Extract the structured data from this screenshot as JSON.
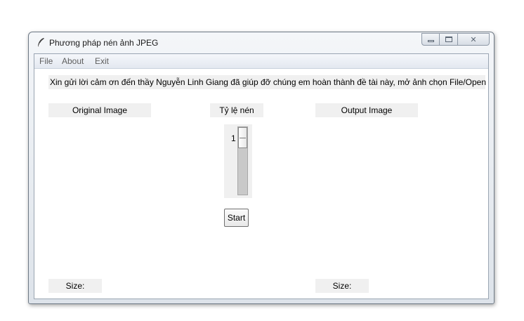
{
  "window": {
    "title": "Phương pháp nén ảnh JPEG",
    "controls": {
      "minimize": "—",
      "maximize": "□",
      "close": "✕"
    }
  },
  "menu": {
    "items": [
      "File",
      "About",
      "Exit"
    ]
  },
  "banner": {
    "text": "Xin gửi lời cảm ơn đến thầy Nguyễn Linh Giang đã giúp đỡ chúng em hoàn thành đề tài này, mở ảnh chọn File/Open"
  },
  "panels": {
    "original_label": "Original Image",
    "output_label": "Output Image",
    "original_size_label": "Size:",
    "output_size_label": "Size:"
  },
  "compression": {
    "label": "Tỷ lệ nén",
    "value": "1",
    "level_fraction": 0.0
  },
  "actions": {
    "start_label": "Start"
  },
  "icons": {
    "app": "feather-icon",
    "minimize": "minimize-icon",
    "maximize": "maximize-icon",
    "close": "close-icon"
  }
}
